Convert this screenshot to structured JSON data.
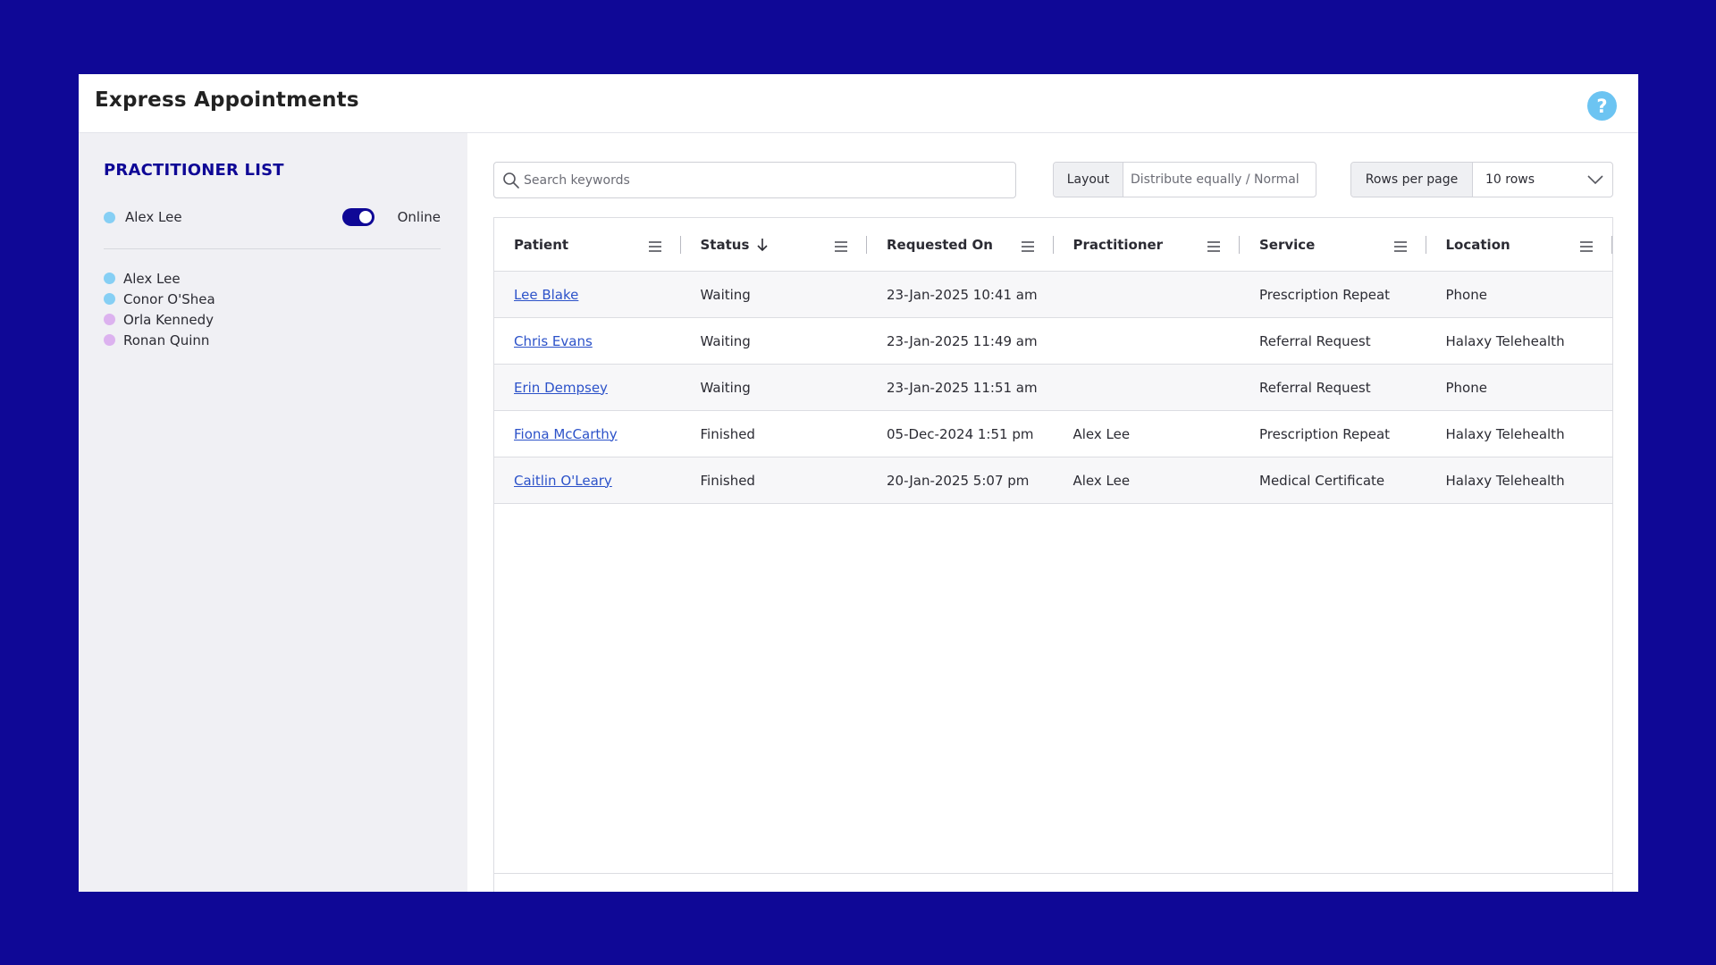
{
  "app": {
    "title": "Express Appointments",
    "help_label": "?"
  },
  "colors": {
    "background": "#0f0896",
    "accent": "#0f0896",
    "help": "#6cc4f2",
    "link": "#2c52c9",
    "dot_blue": "#86cff4",
    "dot_purple": "#dcb2ef"
  },
  "sidebar": {
    "title": "PRACTITIONER LIST",
    "current_user": {
      "name": "Alex Lee",
      "status": "Online",
      "toggle_on": true,
      "dot_color": "#86cff4"
    },
    "practitioners": [
      {
        "name": "Alex Lee",
        "dot_color": "#86cff4"
      },
      {
        "name": "Conor O'Shea",
        "dot_color": "#86cff4"
      },
      {
        "name": "Orla Kennedy",
        "dot_color": "#dcb2ef"
      },
      {
        "name": "Ronan Quinn",
        "dot_color": "#dcb2ef"
      }
    ]
  },
  "toolbar": {
    "search_placeholder": "Search keywords",
    "layout_label": "Layout",
    "layout_value": "Distribute equally / Normal",
    "rows_label": "Rows per page",
    "rows_value": "10 rows"
  },
  "table": {
    "columns": [
      "Patient",
      "Status",
      "Requested On",
      "Practitioner",
      "Service",
      "Location"
    ],
    "sorted_column": "Status",
    "sort_direction": "descending",
    "rows": [
      {
        "patient": "Lee Blake",
        "status": "Waiting",
        "requested_on": "23-Jan-2025 10:41 am",
        "practitioner": "",
        "service": "Prescription Repeat",
        "location": "Phone"
      },
      {
        "patient": "Chris Evans",
        "status": "Waiting",
        "requested_on": "23-Jan-2025 11:49 am",
        "practitioner": "",
        "service": "Referral Request",
        "location": "Halaxy Telehealth"
      },
      {
        "patient": "Erin Dempsey",
        "status": "Waiting",
        "requested_on": "23-Jan-2025 11:51 am",
        "practitioner": "",
        "service": "Referral Request",
        "location": "Phone"
      },
      {
        "patient": "Fiona McCarthy",
        "status": "Finished",
        "requested_on": "05-Dec-2024 1:51 pm",
        "practitioner": "Alex Lee",
        "service": "Prescription Repeat",
        "location": "Halaxy Telehealth"
      },
      {
        "patient": "Caitlin O'Leary",
        "status": "Finished",
        "requested_on": "20-Jan-2025 5:07 pm",
        "practitioner": "Alex Lee",
        "service": "Medical Certificate",
        "location": "Halaxy Telehealth"
      }
    ]
  }
}
